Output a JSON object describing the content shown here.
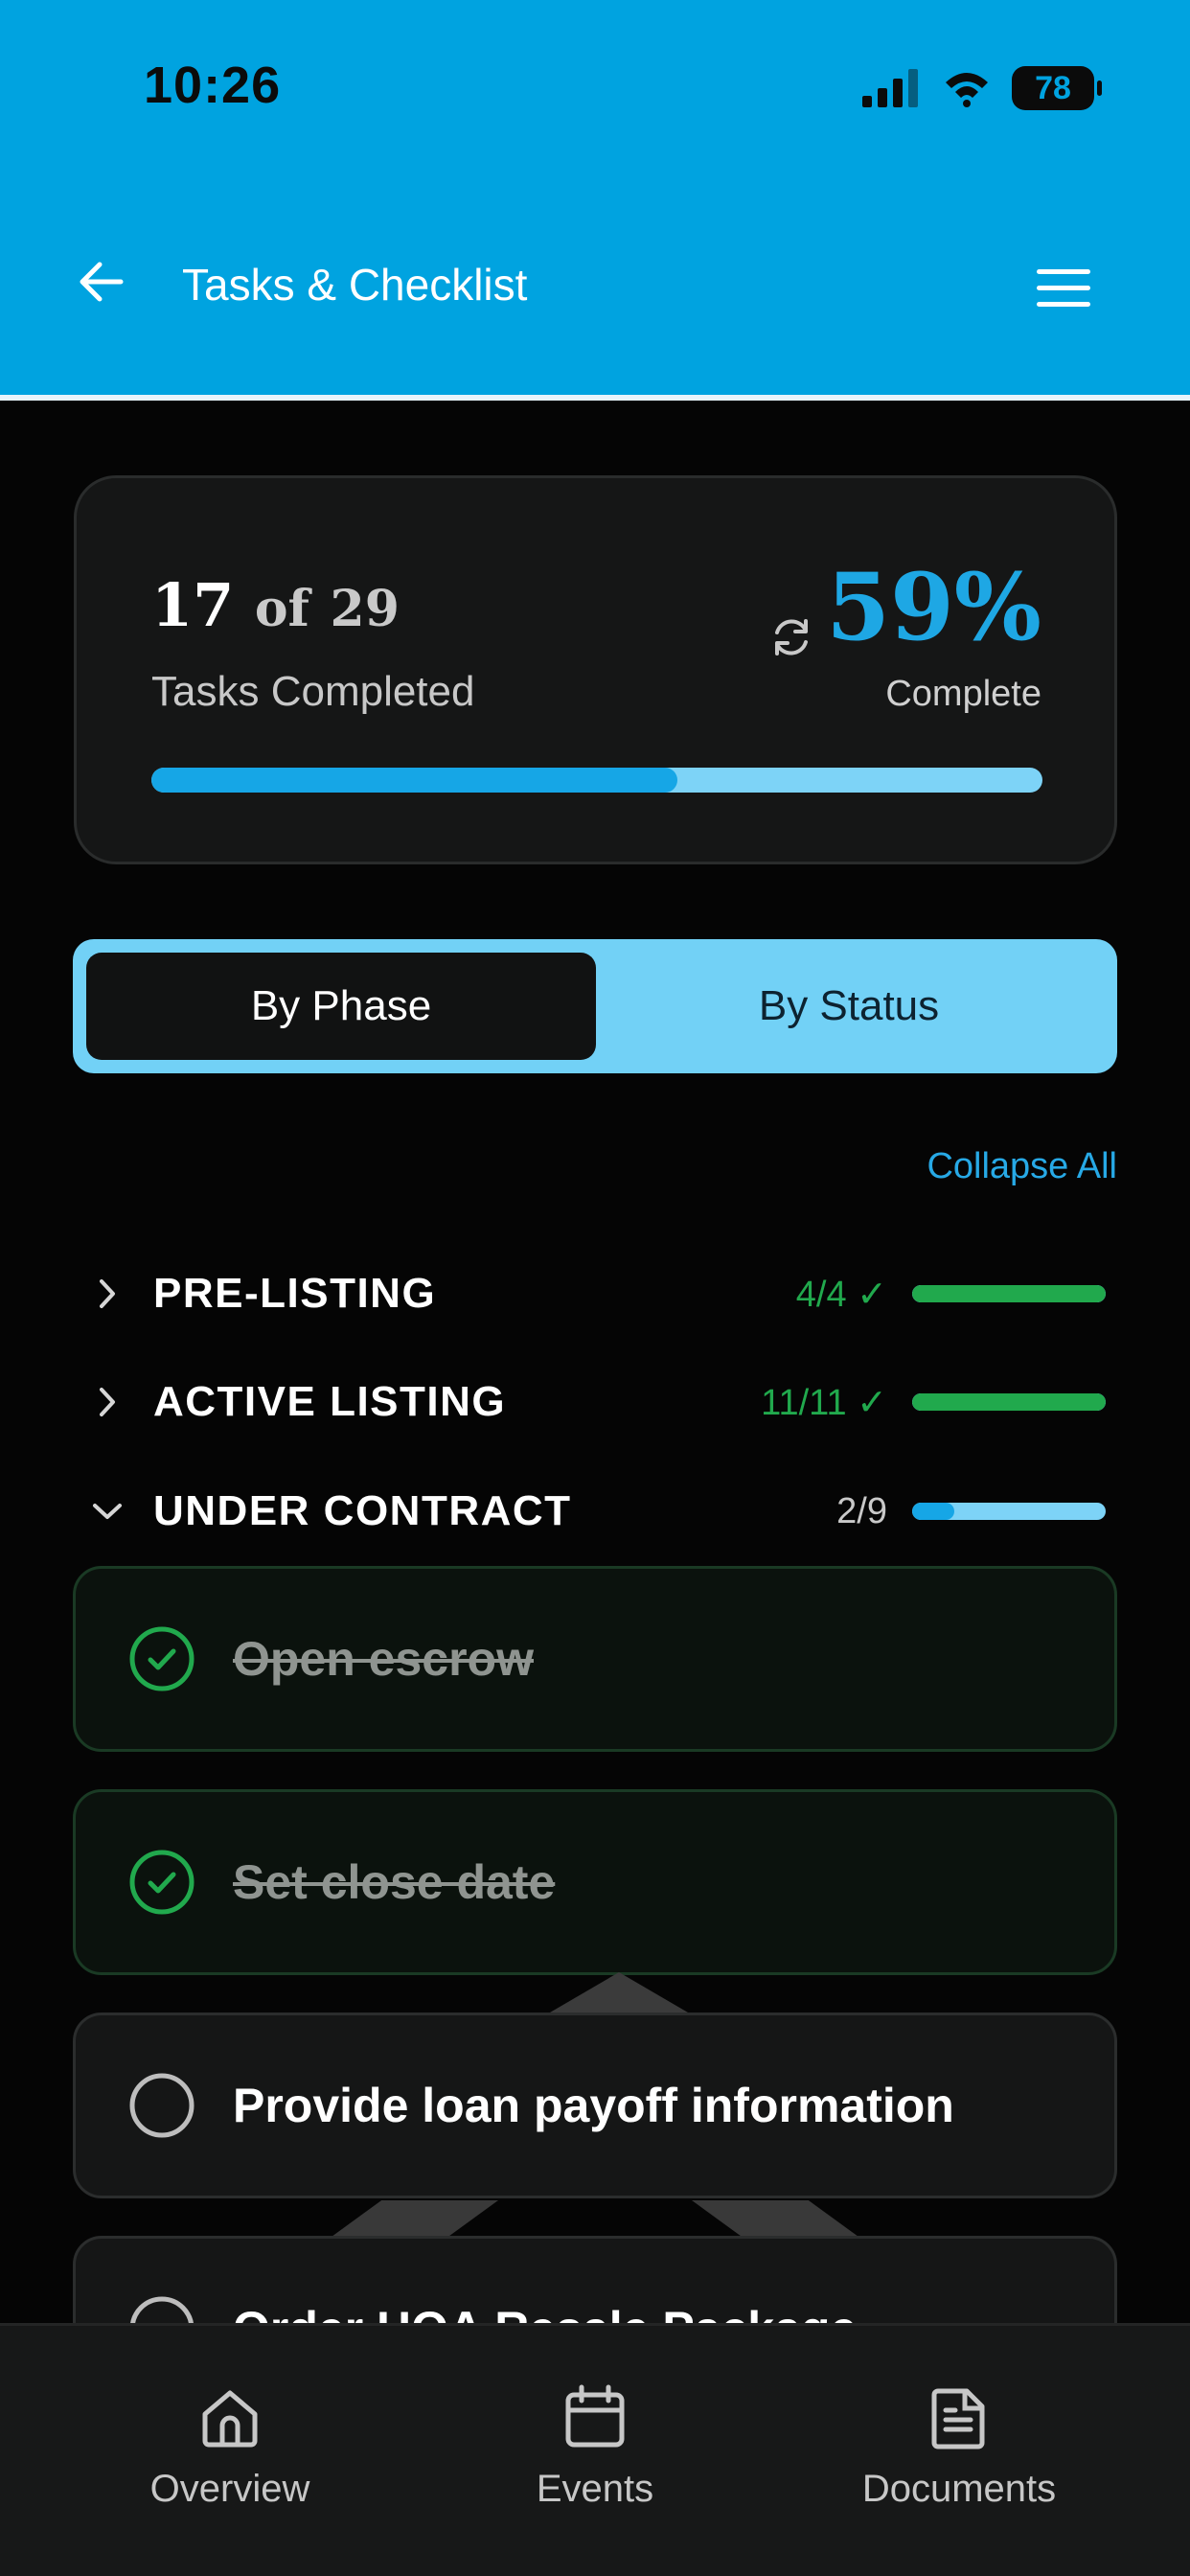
{
  "status_bar": {
    "time": "10:26",
    "battery": "78"
  },
  "header": {
    "title": "Tasks & Checklist",
    "back_icon": "arrow-left-icon",
    "menu_icon": "hamburger-menu-icon"
  },
  "summary": {
    "completed": "17",
    "of_text": "of",
    "total": "29",
    "label": "Tasks Completed",
    "percent_text": "59%",
    "percent_label": "Complete",
    "progress": 0.59,
    "refresh_icon": "refresh-icon"
  },
  "segmented_control": {
    "options": [
      "By Phase",
      "By Status"
    ],
    "selected": "By Phase"
  },
  "collapse_all_label": "Collapse All",
  "phases": [
    {
      "name": "PRE-LISTING",
      "count": "4/4 ✓",
      "progress": 1.0,
      "expanded": false,
      "status": "complete"
    },
    {
      "name": "ACTIVE LISTING",
      "count": "11/11 ✓",
      "progress": 1.0,
      "expanded": false,
      "status": "complete"
    },
    {
      "name": "UNDER CONTRACT",
      "count": "2/9",
      "progress": 0.22,
      "expanded": true,
      "status": "in-progress"
    }
  ],
  "tasks": [
    {
      "title": "Open escrow",
      "done": true
    },
    {
      "title": "Set close date",
      "done": true
    },
    {
      "title": "Provide loan payoff information",
      "done": false
    },
    {
      "title": "Order HOA Resale Package",
      "done": false
    }
  ],
  "bottom_nav": [
    {
      "label": "Overview",
      "icon": "home-icon"
    },
    {
      "label": "Events",
      "icon": "calendar-icon"
    },
    {
      "label": "Documents",
      "icon": "document-icon"
    }
  ],
  "colors": {
    "header_bg": "#00a3e0",
    "accent": "#16a6e6",
    "accent_light": "#7dd3f7",
    "success": "#21a94d",
    "background": "#050505",
    "card": "#151616"
  }
}
